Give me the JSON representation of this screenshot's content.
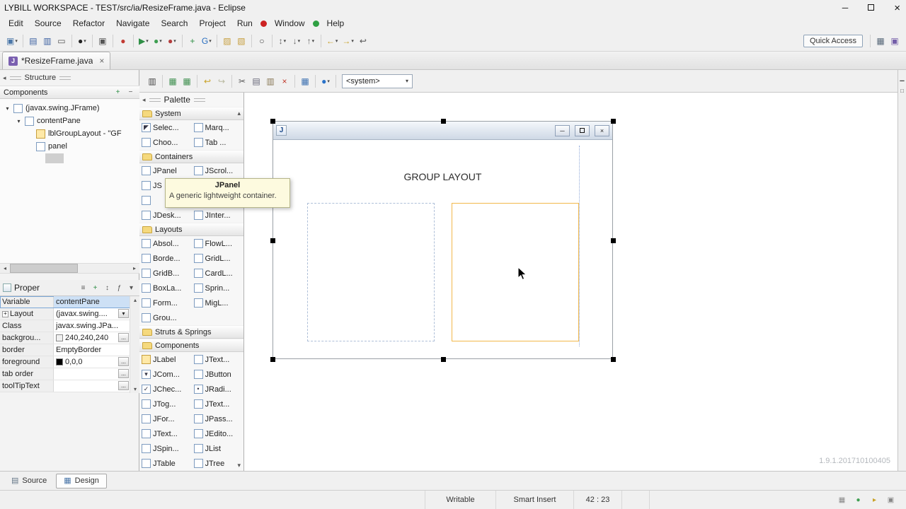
{
  "titlebar": {
    "title": "LYBILL WORKSPACE - TEST/src/ia/ResizeFrame.java - Eclipse",
    "controls": [
      {
        "name": "minimize-icon",
        "glyph": "─"
      },
      {
        "name": "maximize-icon",
        "glyph": "box"
      },
      {
        "name": "close-icon",
        "glyph": "×"
      }
    ]
  },
  "menubar": {
    "items": [
      "Edit",
      "Source",
      "Refactor",
      "Navigate",
      "Search",
      "Project",
      "Run",
      "Window",
      "Help"
    ],
    "record_dot_color": "#cc2222",
    "play_dot_color": "#2fa043"
  },
  "toolbar": {
    "quick_access_label": "Quick Access",
    "items": [
      {
        "name": "new-wizard-icon",
        "glyph": "▣",
        "color": "#4a76a8",
        "dd": true
      },
      {
        "sep": true
      },
      {
        "name": "save-icon",
        "glyph": "▤",
        "color": "#3a5fa0"
      },
      {
        "name": "save-all-icon",
        "glyph": "▥",
        "color": "#3a5fa0"
      },
      {
        "name": "print-icon",
        "glyph": "▭",
        "color": "#555555"
      },
      {
        "sep": true
      },
      {
        "name": "user-profile-icon",
        "glyph": "●",
        "color": "#222222",
        "dd": true
      },
      {
        "sep": true
      },
      {
        "name": "console-icon",
        "glyph": "▣",
        "color": "#555555"
      },
      {
        "sep": true
      },
      {
        "name": "record-icon",
        "glyph": "●",
        "color": "#c23b33"
      },
      {
        "sep": true
      },
      {
        "name": "coverage-icon",
        "glyph": "▶",
        "color": "#2f8f46",
        "dd": true
      },
      {
        "name": "run-icon",
        "glyph": "●",
        "color": "#3f9f52",
        "dd": true
      },
      {
        "name": "debug-icon",
        "glyph": "●",
        "color": "#b43c3c",
        "dd": true
      },
      {
        "sep": true
      },
      {
        "name": "new-java-class-icon",
        "glyph": "+",
        "color": "#2f8f46"
      },
      {
        "name": "external-tools-icon",
        "glyph": "G",
        "color": "#2a6fc0",
        "dd": true
      },
      {
        "sep": true
      },
      {
        "name": "open-folder-icon",
        "glyph": "▨",
        "color": "#c79f3f"
      },
      {
        "name": "import-folder-icon",
        "glyph": "▧",
        "color": "#c79f3f"
      },
      {
        "sep": true
      },
      {
        "name": "search-icon",
        "glyph": "○",
        "color": "#444444"
      },
      {
        "sep": true
      },
      {
        "name": "annotations-icon",
        "glyph": "↕",
        "color": "#666666",
        "dd": true
      },
      {
        "name": "next-annotation-icon",
        "glyph": "↓",
        "color": "#666666",
        "dd": true
      },
      {
        "name": "prev-annotation-icon",
        "glyph": "↑",
        "color": "#666666",
        "dd": true
      },
      {
        "sep": true
      },
      {
        "name": "back-icon",
        "glyph": "←",
        "color": "#c9a227",
        "dd": true
      },
      {
        "name": "forward-icon",
        "glyph": "→",
        "color": "#c9a227",
        "dd": true
      },
      {
        "name": "last-edit-location-icon",
        "glyph": "↩",
        "color": "#555555"
      }
    ],
    "right_items": [
      {
        "name": "open-perspective-icon",
        "glyph": "▦",
        "color": "#556677"
      },
      {
        "name": "java-perspective-icon",
        "glyph": "▣",
        "color": "#735da8"
      }
    ]
  },
  "editor": {
    "tab_label": "*ResizeFrame.java"
  },
  "design_toolbar": {
    "items": [
      {
        "name": "structure-toggle-icon",
        "glyph": "▥",
        "color": "#444444"
      },
      {
        "sep": true
      },
      {
        "name": "test-frame-icon",
        "glyph": "▦",
        "color": "#3f8f4f"
      },
      {
        "name": "refresh-icon",
        "glyph": "▦",
        "color": "#3f8f4f"
      },
      {
        "sep": true
      },
      {
        "name": "undo-icon",
        "glyph": "↩",
        "color": "#c9a227"
      },
      {
        "name": "redo-icon",
        "glyph": "↪",
        "color": "#b9b9a0"
      },
      {
        "sep": true
      },
      {
        "name": "cut-icon",
        "glyph": "✂",
        "color": "#555555"
      },
      {
        "name": "copy-icon",
        "glyph": "▤",
        "color": "#666677"
      },
      {
        "name": "paste-icon",
        "glyph": "▥",
        "color": "#887755"
      },
      {
        "name": "delete-icon",
        "glyph": "×",
        "color": "#c0392b"
      },
      {
        "sep": true
      },
      {
        "name": "table-icon",
        "glyph": "▦",
        "color": "#3a6fb0"
      },
      {
        "sep": true
      },
      {
        "name": "locale-globe-icon",
        "glyph": "●",
        "color": "#2a72c8",
        "dd": true
      },
      {
        "sep": true
      }
    ],
    "system_combo": "<system>"
  },
  "structure_panel": {
    "header": "Structure",
    "section_label": "Components",
    "section_icons": [
      {
        "name": "expand-all-icon",
        "glyph": "+",
        "color": "#2f8f46"
      },
      {
        "name": "collapse-all-icon",
        "glyph": "−",
        "color": "#555555"
      }
    ],
    "tree": [
      {
        "label": "(javax.swing.JFrame)",
        "depth": 0,
        "expander": "▾",
        "icon": "jframe-icon"
      },
      {
        "label": "contentPane",
        "depth": 1,
        "expander": "▾",
        "icon": "content-pane-icon"
      },
      {
        "label": "lblGroupLayout - \"GF",
        "depth": 2,
        "expander": "",
        "icon": "jlabel-icon"
      },
      {
        "label": "panel",
        "depth": 2,
        "expander": "",
        "icon": "jpanel-icon"
      }
    ]
  },
  "properties_panel": {
    "tab_label": "Proper",
    "header_icons": [
      {
        "name": "goto-definition-icon",
        "glyph": "≡",
        "color": "#555555"
      },
      {
        "name": "advanced-properties-icon",
        "glyph": "+",
        "color": "#2f8f46"
      },
      {
        "name": "sort-icon",
        "glyph": "↕",
        "color": "#555555"
      },
      {
        "name": "show-events-icon",
        "glyph": "ƒ",
        "color": "#555555"
      },
      {
        "name": "view-menu-icon",
        "glyph": "▾",
        "color": "#555555"
      }
    ],
    "rows": [
      {
        "name": "Variable",
        "value": "contentPane",
        "selected": true
      },
      {
        "name": "Layout",
        "value": "(javax.swing....",
        "expand": "+",
        "control": "dropdown"
      },
      {
        "name": "Class",
        "value": "javax.swing.JPa..."
      },
      {
        "name": "backgrou...",
        "value": "240,240,240",
        "swatch": "#f0f0f0",
        "control": "ellipsis"
      },
      {
        "name": "border",
        "value": "EmptyBorder"
      },
      {
        "name": "foreground",
        "value": "0,0,0",
        "swatch": "#000000",
        "control": "ellipsis"
      },
      {
        "name": "tab order",
        "value": "",
        "control": "ellipsis"
      },
      {
        "name": "toolTipText",
        "value": "",
        "control": "ellipsis"
      }
    ]
  },
  "palette": {
    "header": "Palette",
    "categories": [
      {
        "name": "System",
        "items": [
          {
            "label": "Selec...",
            "icon": "selection-cursor-icon"
          },
          {
            "label": "Marq...",
            "icon": "marquee-icon"
          },
          {
            "label": "Choo...",
            "icon": "choose-component-icon"
          },
          {
            "label": "Tab ...",
            "icon": "tab-order-icon"
          }
        ]
      },
      {
        "name": "Containers",
        "items": [
          {
            "label": "JPanel",
            "icon": "jpanel-icon"
          },
          {
            "label": "JScrol...",
            "icon": "jscrollpane-icon"
          },
          {
            "label": "JS",
            "icon": "jsplitpane-icon"
          },
          {
            "label": "",
            "icon": "jtabbedpane-icon"
          },
          {
            "label": "",
            "icon": "jtoolbar-icon"
          },
          {
            "label": "",
            "icon": "jlayeredpane-icon"
          },
          {
            "label": "JDesk...",
            "icon": "jdesktoppane-icon"
          },
          {
            "label": "JInter...",
            "icon": "jinternalframe-icon"
          }
        ]
      },
      {
        "name": "Layouts",
        "items": [
          {
            "label": "Absol...",
            "icon": "absolute-layout-icon"
          },
          {
            "label": "FlowL...",
            "icon": "flow-layout-icon"
          },
          {
            "label": "Borde...",
            "icon": "border-layout-icon"
          },
          {
            "label": "GridL...",
            "icon": "grid-layout-icon"
          },
          {
            "label": "GridB...",
            "icon": "gridbag-layout-icon"
          },
          {
            "label": "CardL...",
            "icon": "card-layout-icon"
          },
          {
            "label": "BoxLa...",
            "icon": "box-layout-icon"
          },
          {
            "label": "Sprin...",
            "icon": "spring-layout-icon"
          },
          {
            "label": "Form...",
            "icon": "form-layout-icon"
          },
          {
            "label": "MigL...",
            "icon": "mig-layout-icon"
          },
          {
            "label": "Grou...",
            "icon": "group-layout-icon"
          }
        ]
      },
      {
        "name": "Struts & Springs",
        "items": []
      },
      {
        "name": "Components",
        "items": [
          {
            "label": "JLabel",
            "icon": "jlabel-icon"
          },
          {
            "label": "JText...",
            "icon": "jtextfield-icon"
          },
          {
            "label": "JCom...",
            "icon": "jcombobox-icon"
          },
          {
            "label": "JButton",
            "icon": "jbutton-icon"
          },
          {
            "label": "JChec...",
            "icon": "jcheckbox-icon"
          },
          {
            "label": "JRadi...",
            "icon": "jradiobutton-icon"
          },
          {
            "label": "JTog...",
            "icon": "jtogglebutton-icon"
          },
          {
            "label": "JText...",
            "icon": "jtextarea-icon"
          },
          {
            "label": "JFor...",
            "icon": "jformattedtextfield-icon"
          },
          {
            "label": "JPass...",
            "icon": "jpasswordfield-icon"
          },
          {
            "label": "JText...",
            "icon": "jtextpane-icon"
          },
          {
            "label": "JEdito...",
            "icon": "jeditorpane-icon"
          },
          {
            "label": "JSpin...",
            "icon": "jspinner-icon"
          },
          {
            "label": "JList",
            "icon": "jlist-icon"
          },
          {
            "label": "JTable",
            "icon": "jtable-icon"
          },
          {
            "label": "JTree",
            "icon": "jtree-icon"
          }
        ]
      }
    ]
  },
  "tooltip": {
    "title": "JPanel",
    "body": "A generic lightweight container."
  },
  "design_canvas": {
    "frame_label": "GROUP LAYOUT",
    "version": "1.9.1.201710100405"
  },
  "bottom_tabs": {
    "tabs": [
      {
        "label": "Source",
        "icon": "source-tab-icon",
        "active": false
      },
      {
        "label": "Design",
        "icon": "design-tab-icon",
        "active": true
      }
    ]
  },
  "statusbar": {
    "cells": [
      {
        "label": "Writable"
      },
      {
        "label": "Smart Insert"
      },
      {
        "label": "42 : 23"
      }
    ],
    "right_icons": [
      {
        "name": "api-tools-icon",
        "glyph": "▦",
        "color": "#888888"
      },
      {
        "name": "status-ok-icon",
        "glyph": "●",
        "color": "#3f9f52"
      },
      {
        "name": "progress-icon",
        "glyph": "▸",
        "color": "#c9a227"
      },
      {
        "name": "console-status-icon",
        "glyph": "▣",
        "color": "#888888"
      }
    ]
  },
  "right_strip": {
    "icons": [
      {
        "name": "minimize-view-icon",
        "glyph": "▁"
      },
      {
        "name": "maximize-view-icon",
        "glyph": "□"
      }
    ]
  }
}
